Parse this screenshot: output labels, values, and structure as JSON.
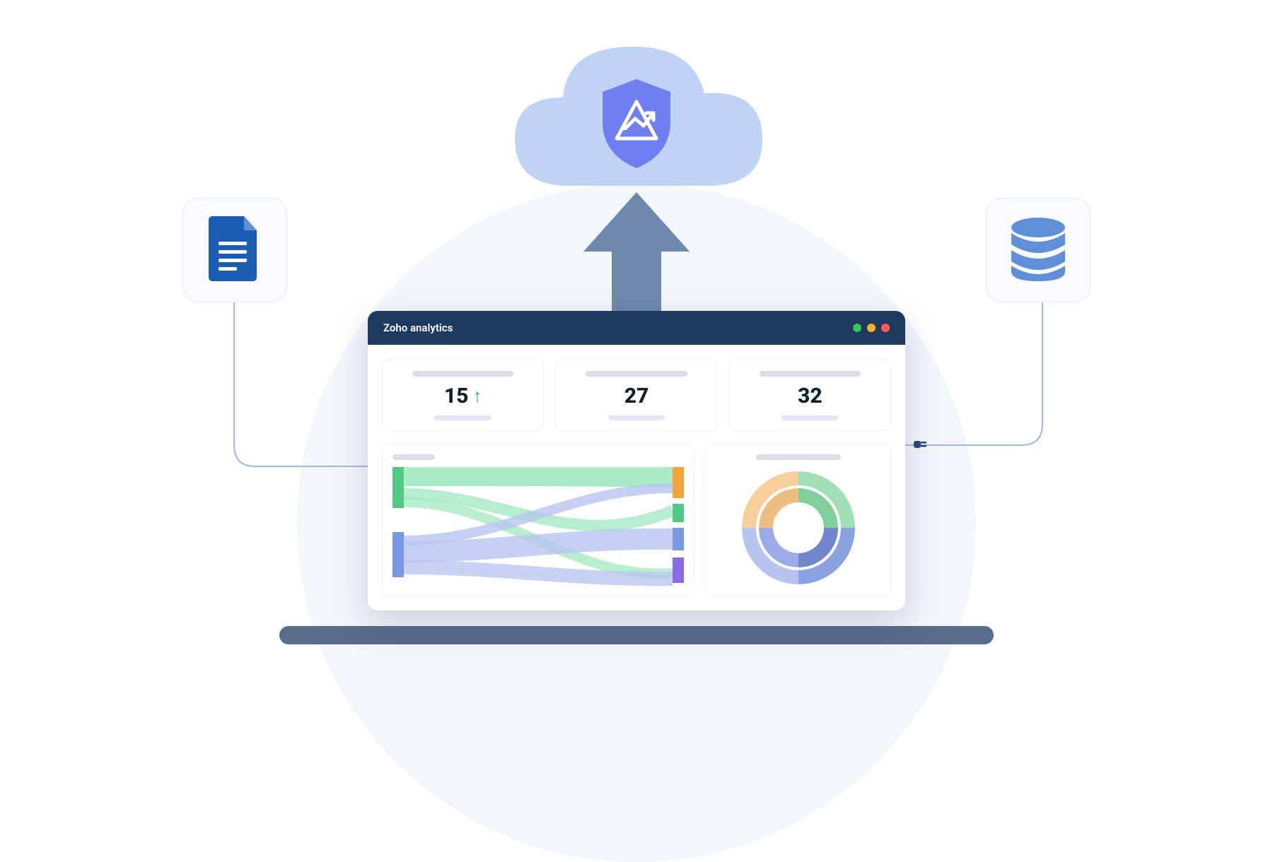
{
  "window": {
    "title": "Zoho analytics",
    "traffic_lights": [
      "green",
      "yellow",
      "red"
    ]
  },
  "kpis": [
    {
      "value": "15",
      "trend": "up"
    },
    {
      "value": "27"
    },
    {
      "value": "32"
    }
  ],
  "icons": {
    "cloud": "cloud-icon",
    "shield": "shield-analytics-icon",
    "upload": "upload-arrow-icon",
    "document": "document-icon",
    "database": "database-icon",
    "plug": "plug-icon"
  },
  "colors": {
    "titlebar": "#1f3a5f",
    "cloud": "#bfd3f6",
    "shield": "#6f7ef0",
    "arrow": "#6f89ad",
    "doc": "#1c5db6",
    "db": "#5f8fd8",
    "connector": "#9fb6e8",
    "platform": "#576d8a"
  },
  "chart_data": [
    {
      "type": "sankey",
      "left_nodes": [
        {
          "color": "#50c985",
          "weight": 40
        },
        {
          "color": "#7898e6",
          "weight": 45
        }
      ],
      "right_nodes": [
        {
          "color": "#f3a43a",
          "weight": 30
        },
        {
          "color": "#50c985",
          "weight": 18
        },
        {
          "color": "#7898e6",
          "weight": 20
        },
        {
          "color": "#8a6ae6",
          "weight": 22
        }
      ],
      "flows": [
        {
          "from": 0,
          "to": 0,
          "color": "#9de7be",
          "weight": 22
        },
        {
          "from": 0,
          "to": 1,
          "color": "#9de7be",
          "weight": 10
        },
        {
          "from": 0,
          "to": 3,
          "color": "#9de7be",
          "weight": 8
        },
        {
          "from": 1,
          "to": 0,
          "color": "#b6c4ef",
          "weight": 8
        },
        {
          "from": 1,
          "to": 2,
          "color": "#b6c4ef",
          "weight": 20
        },
        {
          "from": 1,
          "to": 3,
          "color": "#b6c4ef",
          "weight": 17
        }
      ]
    },
    {
      "type": "donut",
      "rings": 2,
      "series": [
        {
          "name": "outer",
          "values": [
            25,
            22,
            28,
            25
          ],
          "colors": [
            "#f6cf9b",
            "#a1dfb6",
            "#8aa3e0",
            "#b6c4ef"
          ]
        },
        {
          "name": "inner",
          "values": [
            25,
            22,
            28,
            25
          ],
          "colors": [
            "#eebd7f",
            "#7fcf9a",
            "#6f87cf",
            "#9aaae6"
          ]
        }
      ]
    }
  ]
}
